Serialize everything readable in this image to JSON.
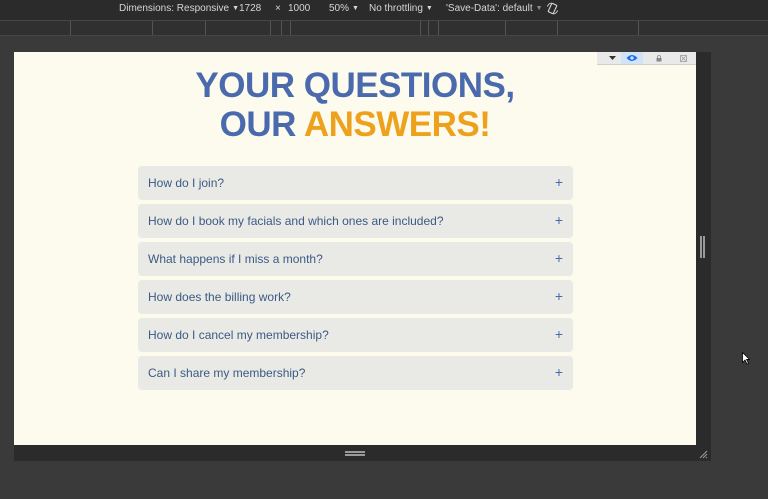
{
  "devtools": {
    "dimensions_label": "Dimensions: Responsive",
    "width": "1728",
    "times": "×",
    "height": "1000",
    "zoom": "50%",
    "throttling": "No throttling",
    "save_data": "'Save-Data': default"
  },
  "page": {
    "headline_line1": "YOUR QUESTIONS,",
    "headline_line2_a": "OUR ",
    "headline_line2_b": "ANSWERS!",
    "faqs": [
      {
        "question": "How do I join?",
        "toggle": "+"
      },
      {
        "question": "How do I book my facials and which ones are included?",
        "toggle": "+"
      },
      {
        "question": "What happens if I miss a month?",
        "toggle": "+"
      },
      {
        "question": "How does the billing work?",
        "toggle": "+"
      },
      {
        "question": "How do I cancel my membership?",
        "toggle": "+"
      },
      {
        "question": "Can I share my membership?",
        "toggle": "+"
      }
    ]
  },
  "colors": {
    "headline_blue": "#4a6aad",
    "headline_accent": "#eda11c",
    "page_background": "#fcfbee",
    "faq_background": "#e9eae5"
  }
}
